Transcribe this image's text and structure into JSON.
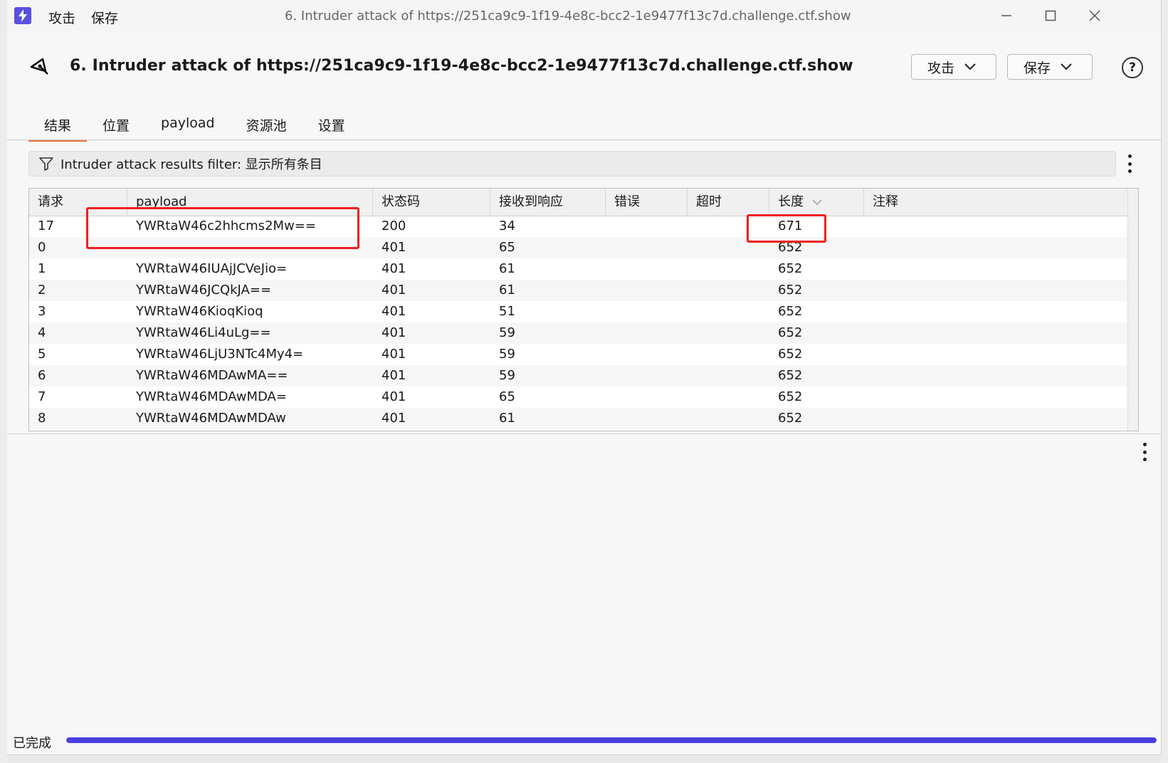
{
  "titlebar": {
    "menu": [
      "攻击",
      "保存"
    ],
    "title": "6. Intruder attack of https://251ca9c9-1f19-4e8c-bcc2-1e9477f13c7d.challenge.ctf.show"
  },
  "header": {
    "title": "6. Intruder attack of https://251ca9c9-1f19-4e8c-bcc2-1e9477f13c7d.challenge.ctf.show",
    "attack_button": "攻击",
    "save_button": "保存",
    "help_symbol": "?"
  },
  "tabs": [
    "结果",
    "位置",
    "payload",
    "资源池",
    "设置"
  ],
  "active_tab": "结果",
  "filter": {
    "label": "Intruder attack results filter: 显示所有条目"
  },
  "table": {
    "columns": [
      "请求",
      "payload",
      "状态码",
      "接收到响应",
      "错误",
      "超时",
      "长度",
      "注释"
    ],
    "sort_column": "长度",
    "rows": [
      {
        "req": "17",
        "payload": "YWRtaW46c2hhcms2Mw==",
        "status": "200",
        "resp": "34",
        "err": "",
        "timeout": "",
        "len": "671",
        "note": ""
      },
      {
        "req": "0",
        "payload": "",
        "status": "401",
        "resp": "65",
        "err": "",
        "timeout": "",
        "len": "652",
        "note": ""
      },
      {
        "req": "1",
        "payload": "YWRtaW46IUAjJCVeJio=",
        "status": "401",
        "resp": "61",
        "err": "",
        "timeout": "",
        "len": "652",
        "note": ""
      },
      {
        "req": "2",
        "payload": "YWRtaW46JCQkJA==",
        "status": "401",
        "resp": "61",
        "err": "",
        "timeout": "",
        "len": "652",
        "note": ""
      },
      {
        "req": "3",
        "payload": "YWRtaW46KioqKioq",
        "status": "401",
        "resp": "51",
        "err": "",
        "timeout": "",
        "len": "652",
        "note": ""
      },
      {
        "req": "4",
        "payload": "YWRtaW46Li4uLg==",
        "status": "401",
        "resp": "59",
        "err": "",
        "timeout": "",
        "len": "652",
        "note": ""
      },
      {
        "req": "5",
        "payload": "YWRtaW46LjU3NTc4My4=",
        "status": "401",
        "resp": "59",
        "err": "",
        "timeout": "",
        "len": "652",
        "note": ""
      },
      {
        "req": "6",
        "payload": "YWRtaW46MDAwMA==",
        "status": "401",
        "resp": "59",
        "err": "",
        "timeout": "",
        "len": "652",
        "note": ""
      },
      {
        "req": "7",
        "payload": "YWRtaW46MDAwMDA=",
        "status": "401",
        "resp": "65",
        "err": "",
        "timeout": "",
        "len": "652",
        "note": ""
      },
      {
        "req": "8",
        "payload": "YWRtaW46MDAwMDAw",
        "status": "401",
        "resp": "61",
        "err": "",
        "timeout": "",
        "len": "652",
        "note": ""
      }
    ]
  },
  "status": {
    "text": "已完成",
    "progress": 1.0
  },
  "colors": {
    "accent": "#5b4fe0",
    "progress": "#4a3fe0",
    "tab_underline": "#e8723a",
    "highlight_box": "#f0201e"
  },
  "icons": {
    "app": "burp-bolt-icon",
    "back": "intruder-target-icon",
    "filter": "funnel-icon",
    "help": "help-circle-icon",
    "menu": "kebab-menu-icon"
  }
}
